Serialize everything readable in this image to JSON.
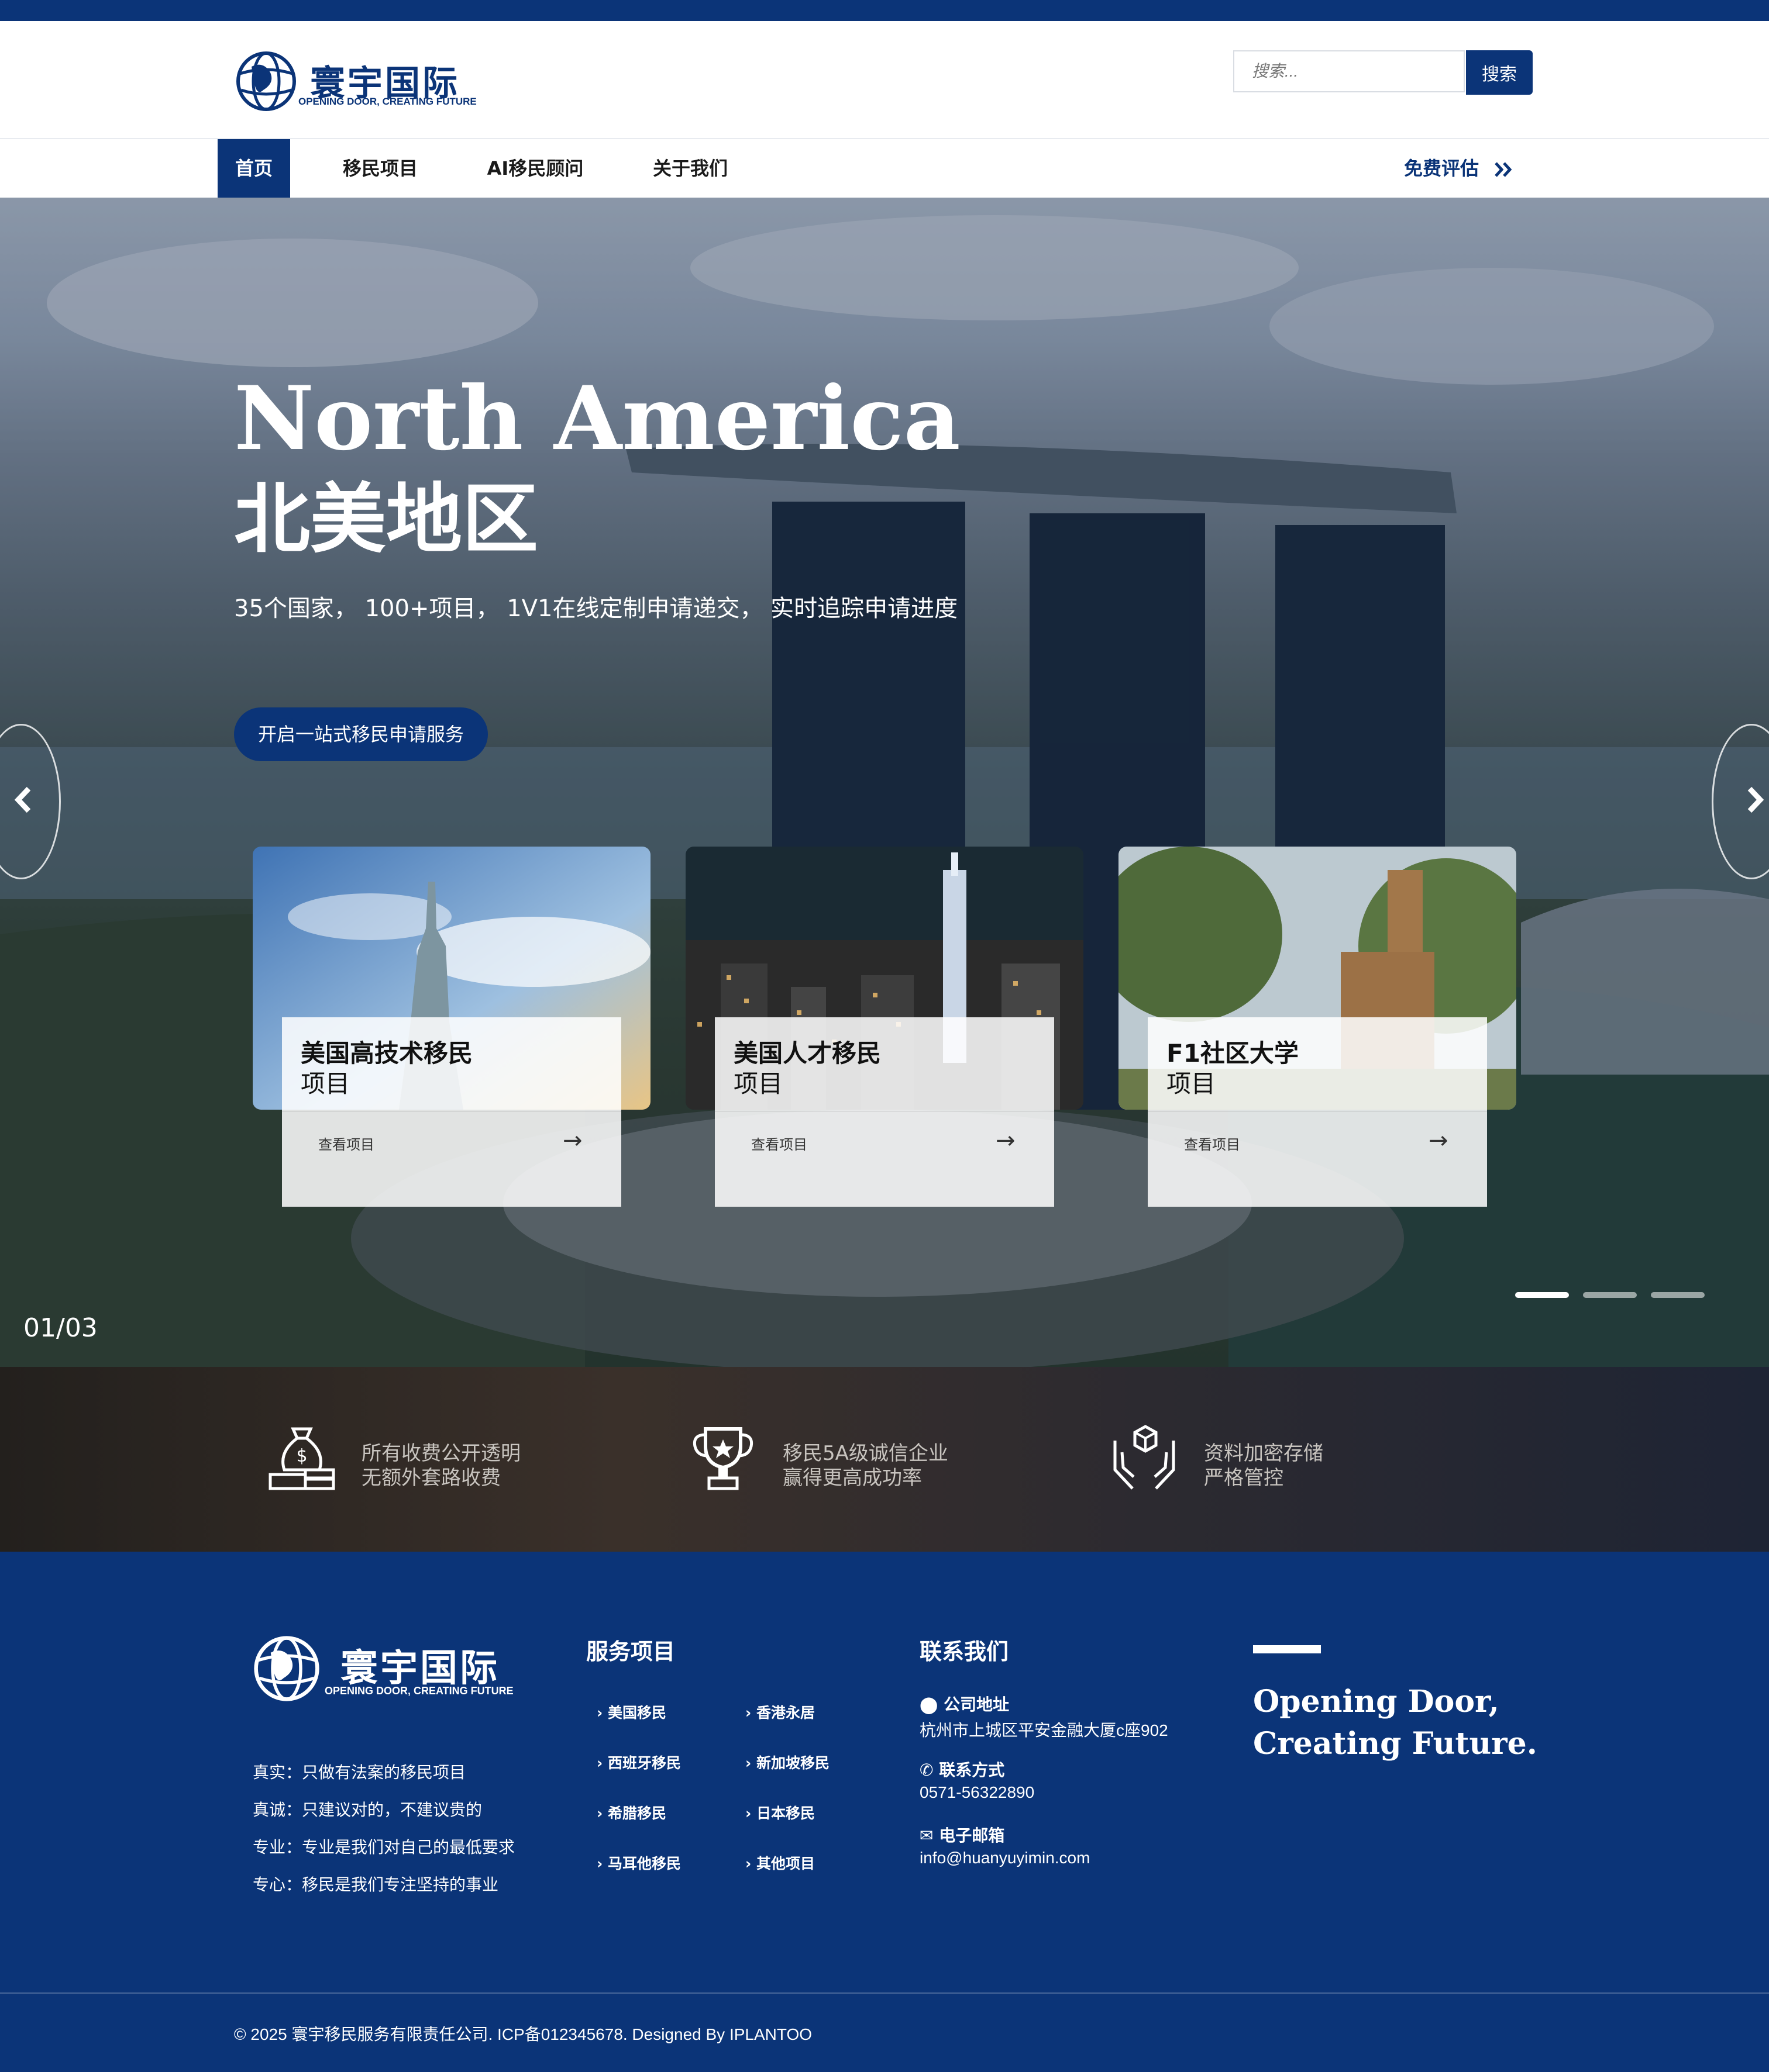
{
  "brand": {
    "name": "寰宇国际",
    "tagline": "OPENING DOOR, CREATING FUTURE"
  },
  "search": {
    "placeholder": "搜索...",
    "button_label": "搜索"
  },
  "nav": {
    "items": [
      {
        "label": "首页",
        "active": true
      },
      {
        "label": "移民项目",
        "active": false
      },
      {
        "label": "AI移民顾问",
        "active": false
      },
      {
        "label": "关于我们",
        "active": false
      }
    ],
    "cta_label": "免费评估"
  },
  "hero": {
    "title_en": "North America",
    "title_zh": "北美地区",
    "subtitle": "35个国家， 100+项目， 1V1在线定制申请递交， 实时追踪申请进度",
    "cta_label": "开启一站式移民申请服务",
    "counter": "01/03",
    "slide_index": 1,
    "slide_total": 3,
    "cards": [
      {
        "title": "美国高技术移民",
        "subtitle": "项目",
        "link_label": "查看项目"
      },
      {
        "title": "美国人才移民",
        "subtitle": "项目",
        "link_label": "查看项目"
      },
      {
        "title": "F1社区大学",
        "subtitle": "项目",
        "link_label": "查看项目"
      }
    ]
  },
  "features": [
    {
      "line1": "所有收费公开透明",
      "line2": "无额外套路收费",
      "icon": "money-bag-icon"
    },
    {
      "line1": "移民5A级诚信企业",
      "line2": "赢得更高成功率",
      "icon": "trophy-icon"
    },
    {
      "line1": "资料加密存储",
      "line2": "严格管控",
      "icon": "secure-box-icon"
    }
  ],
  "footer": {
    "values": [
      "真实：只做有法案的移民项目",
      "真诚：只建议对的，不建议贵的",
      "专业：专业是我们对自己的最低要求",
      "专心：移民是我们专注坚持的事业"
    ],
    "services_heading": "服务项目",
    "services": [
      "美国移民",
      "香港永居",
      "西班牙移民",
      "新加坡移民",
      "希腊移民",
      "日本移民",
      "马耳他移民",
      "其他项目"
    ],
    "contact_heading": "联系我们",
    "contact": {
      "address_label": "公司地址",
      "address": "杭州市上城区平安金融大厦c座902",
      "phone_label": "联系方式",
      "phone": "0571-56322890",
      "email_label": "电子邮箱",
      "email": "info@huanyuyimin.com"
    },
    "slogan_line1": "Opening Door,",
    "slogan_line2": "Creating Future.",
    "copyright": "© 2025 寰宇移民服务有限责任公司. ICP备012345678. Designed By IPLANTOO"
  },
  "colors": {
    "primary": "#0b3478",
    "white": "#ffffff"
  }
}
